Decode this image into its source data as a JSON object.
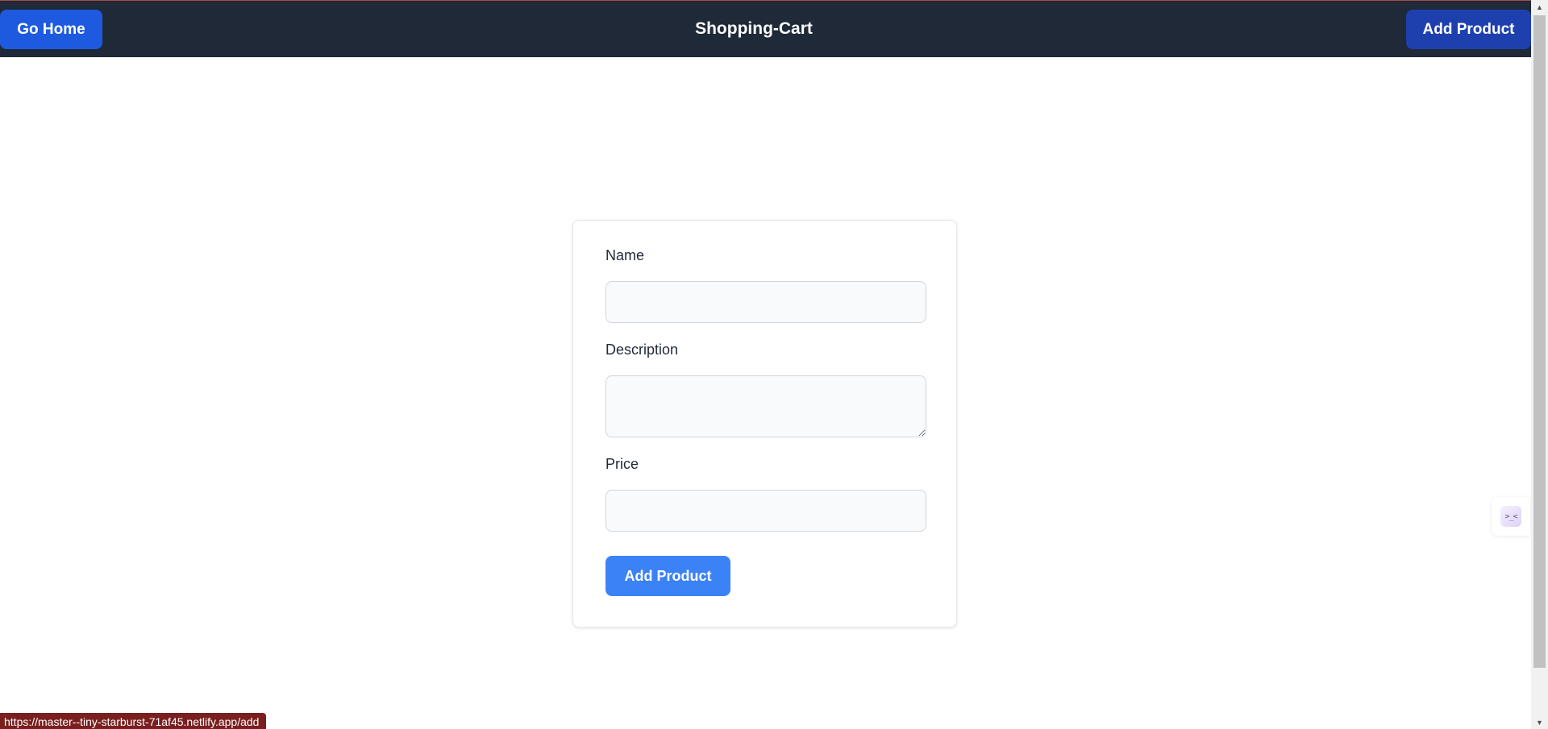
{
  "header": {
    "go_home_label": "Go Home",
    "brand_title": "Shopping-Cart",
    "add_product_label": "Add Product"
  },
  "form": {
    "name_label": "Name",
    "name_value": "",
    "description_label": "Description",
    "description_value": "",
    "price_label": "Price",
    "price_value": "",
    "submit_label": "Add Product"
  },
  "widget": {
    "face_text": ">_<",
    "icon": "emoticon-face-icon"
  },
  "status_bar": {
    "url": "https://master--tiny-starburst-71af45.netlify.app/add"
  },
  "colors": {
    "navbar": "#1f2937",
    "go_home_button": "#1d5ae0",
    "add_product_nav_button": "#1e40af",
    "submit_button": "#3b82f6",
    "status_bar": "#7a1f1f"
  }
}
